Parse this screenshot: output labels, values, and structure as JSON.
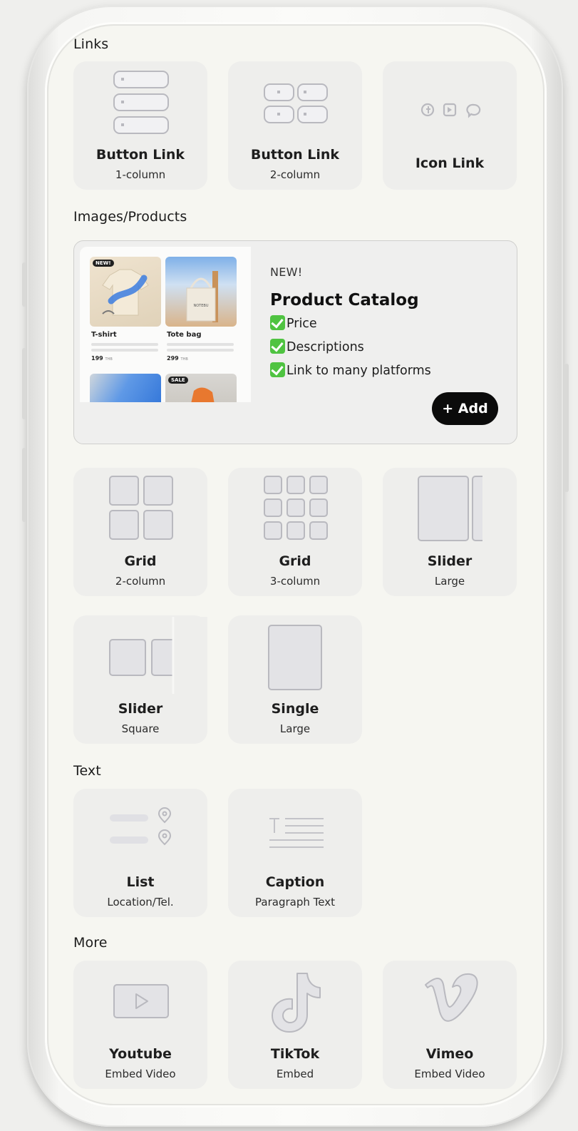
{
  "sections": {
    "links": "Links",
    "images_products": "Images/Products",
    "text": "Text",
    "more": "More"
  },
  "links": [
    {
      "title": "Button Link",
      "subtitle": "1-column",
      "icon": "button-list-1col-icon"
    },
    {
      "title": "Button Link",
      "subtitle": "2-column",
      "icon": "button-list-2col-icon"
    },
    {
      "title": "Icon Link",
      "subtitle": "",
      "icon": "icon-links-icon"
    }
  ],
  "banner": {
    "badge": "NEW!",
    "title": "Product Catalog",
    "features": [
      "Price",
      "Descriptions",
      "Link to many platforms"
    ],
    "add_label": "+ Add",
    "mock": {
      "products": [
        {
          "name": "T-shirt",
          "price": "199",
          "currency": "THB",
          "tag": "NEW!"
        },
        {
          "name": "Tote bag",
          "price": "299",
          "currency": "THB",
          "tag": ""
        }
      ],
      "tote_print": "NOTEBU",
      "sale_tag": "SALE"
    }
  },
  "images": [
    {
      "title": "Grid",
      "subtitle": "2-column",
      "icon": "grid-2col-icon"
    },
    {
      "title": "Grid",
      "subtitle": "3-column",
      "icon": "grid-3col-icon"
    },
    {
      "title": "Slider",
      "subtitle": "Large",
      "icon": "slider-large-icon"
    },
    {
      "title": "Slider",
      "subtitle": "Square",
      "icon": "slider-square-icon"
    },
    {
      "title": "Single",
      "subtitle": "Large",
      "icon": "single-large-icon"
    }
  ],
  "text": [
    {
      "title": "List",
      "subtitle": "Location/Tel.",
      "icon": "list-location-icon"
    },
    {
      "title": "Caption",
      "subtitle": "Paragraph Text",
      "icon": "caption-text-icon"
    }
  ],
  "more": [
    {
      "title": "Youtube",
      "subtitle": "Embed Video",
      "icon": "youtube-icon"
    },
    {
      "title": "TikTok",
      "subtitle": "Embed",
      "icon": "tiktok-icon"
    },
    {
      "title": "Vimeo",
      "subtitle": "Embed Video",
      "icon": "vimeo-icon"
    }
  ],
  "colors": {
    "background": "#efefed",
    "screen": "#f6f6f1",
    "tile": "#eeeeec",
    "icon_stroke": "#b9b9bf",
    "icon_fill": "#e3e3e6",
    "check": "#4fc341",
    "add_button": "#0b0b0b"
  }
}
